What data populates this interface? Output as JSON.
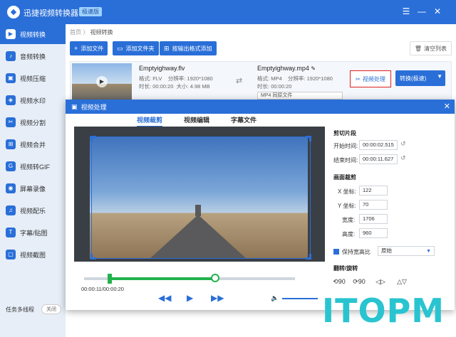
{
  "app": {
    "title": "迅捷视频转换器",
    "edition": "极速版",
    "window_buttons": [
      "☰",
      "—",
      "✕"
    ]
  },
  "sidebar": {
    "items": [
      {
        "label": "视频转换",
        "icon": "▶"
      },
      {
        "label": "音频转换",
        "icon": "♪"
      },
      {
        "label": "视频压缩",
        "icon": "▣"
      },
      {
        "label": "视频水印",
        "icon": "◈"
      },
      {
        "label": "视频分割",
        "icon": "✂"
      },
      {
        "label": "视频合并",
        "icon": "⊞"
      },
      {
        "label": "视频转GIF",
        "icon": "G"
      },
      {
        "label": "屏幕录像",
        "icon": "◉"
      },
      {
        "label": "视频配乐",
        "icon": "♫"
      },
      {
        "label": "字幕/贴图",
        "icon": "T"
      },
      {
        "label": "视频截图",
        "icon": "▢"
      }
    ],
    "footer_label": "任务多线程",
    "footer_toggle": "关闭"
  },
  "main": {
    "breadcrumb_home": "首页",
    "breadcrumb_sep": "〉",
    "breadcrumb_current": "视频转换",
    "buttons": {
      "add_file": "添加文件",
      "add_folder": "添加文件夹",
      "add_by_format": "按输出格式添加",
      "clear": "清空列表"
    },
    "file": {
      "src_name": "Emptyighway.flv",
      "src_format_label": "格式:",
      "src_format": "FLV",
      "src_res_label": "分辨率:",
      "src_res": "1920*1080",
      "src_dur_label": "时长:",
      "src_dur": "00:00:20",
      "src_size_label": "大小:",
      "src_size": "4.98 MB",
      "dst_name": "Emptyighway.mp4",
      "dst_format_label": "格式:",
      "dst_format": "MP4",
      "dst_res_label": "分辨率:",
      "dst_res": "1920*1080",
      "dst_dur_label": "时长:",
      "dst_dur": "00:00:20",
      "dst_select": "MP4  同原文件",
      "process_btn": "视频处理",
      "convert_btn": "转换(极速)"
    }
  },
  "dialog": {
    "title": "视频处理",
    "tabs": [
      "视频裁剪",
      "视频编辑",
      "字幕文件"
    ],
    "current_time": "00:00:11/00:00:20",
    "trim_progress_fraction": 0.62,
    "trim_start_fraction": 0.12,
    "panel": {
      "clip_title": "剪切片段",
      "start_label": "开始时间:",
      "start_value": "00:00:02.515",
      "end_label": "结束时间:",
      "end_value": "00:00:11.627",
      "crop_title": "画面裁剪",
      "x_label": "X 坐标:",
      "x_value": "122",
      "y_label": "Y 坐标:",
      "y_value": "70",
      "w_label": "宽度:",
      "w_value": "1706",
      "h_label": "高度:",
      "h_value": "960",
      "keep_ratio_label": "保持宽高比",
      "ratio_value": "原始",
      "rotate_title": "翻转/旋转",
      "rot_buttons": [
        "⟲90",
        "⟳90",
        "◁▷",
        "△▽"
      ]
    }
  },
  "watermark": "ITOPM"
}
